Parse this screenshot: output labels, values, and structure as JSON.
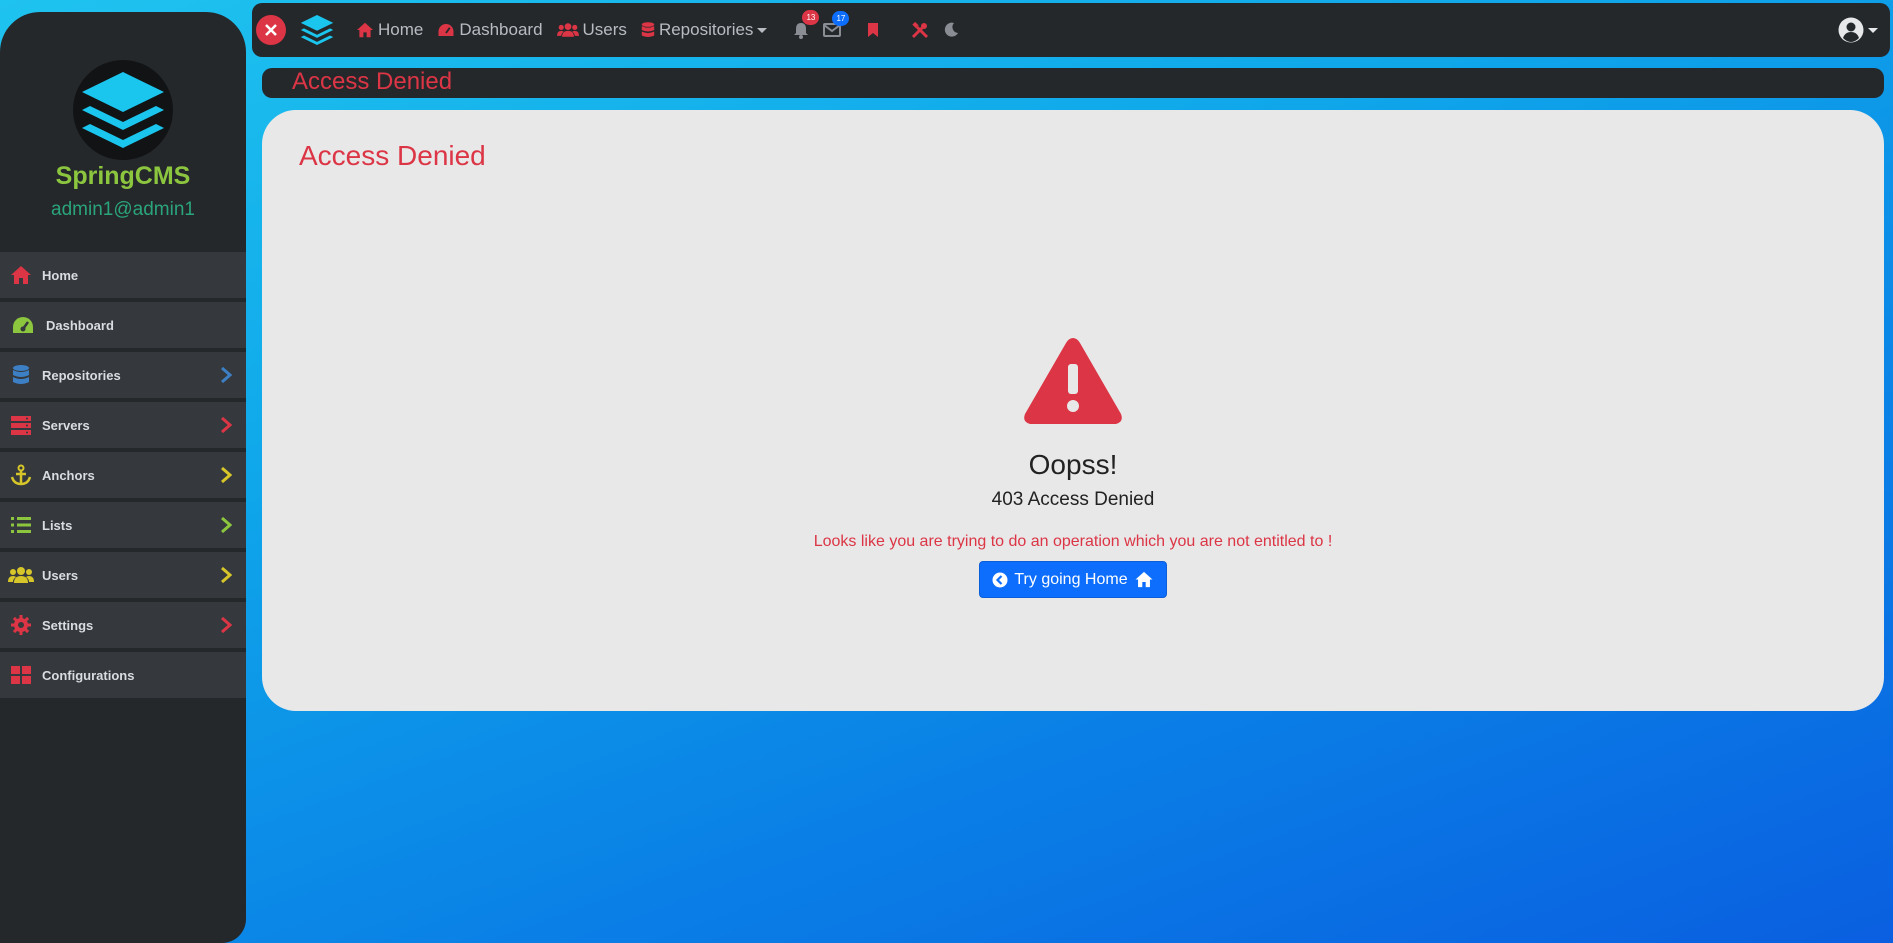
{
  "brand": {
    "name": "SpringCMS",
    "user": "admin1@admin1"
  },
  "sidebar": {
    "items": [
      {
        "label": "Home",
        "icon": "home-icon",
        "color": "#dc3545",
        "has_children": false
      },
      {
        "label": "Dashboard",
        "icon": "gauge-icon",
        "color": "#8cc63f",
        "has_children": false
      },
      {
        "label": "Repositories",
        "icon": "database-icon",
        "color": "#3d7fc4",
        "has_children": true,
        "chevron_color": "#3d7fc4"
      },
      {
        "label": "Servers",
        "icon": "server-icon",
        "color": "#dc3545",
        "has_children": true,
        "chevron_color": "#dc3545"
      },
      {
        "label": "Anchors",
        "icon": "anchor-icon",
        "color": "#d6c62a",
        "has_children": true,
        "chevron_color": "#d6c62a"
      },
      {
        "label": "Lists",
        "icon": "list-icon",
        "color": "#8cc63f",
        "has_children": true,
        "chevron_color": "#8cc63f"
      },
      {
        "label": "Users",
        "icon": "users-icon",
        "color": "#d6c62a",
        "has_children": true,
        "chevron_color": "#d6c62a"
      },
      {
        "label": "Settings",
        "icon": "gear-icon",
        "color": "#dc3545",
        "has_children": true,
        "chevron_color": "#dc3545"
      },
      {
        "label": "Configurations",
        "icon": "grid-icon",
        "color": "#dc3545",
        "has_children": false
      }
    ]
  },
  "topbar": {
    "nav": [
      {
        "label": "Home",
        "icon": "home-icon"
      },
      {
        "label": "Dashboard",
        "icon": "gauge-icon"
      },
      {
        "label": "Users",
        "icon": "users-icon"
      },
      {
        "label": "Repositories",
        "icon": "database-icon",
        "dropdown": true
      }
    ],
    "notifications_count": "13",
    "messages_count": "17"
  },
  "page": {
    "title": "Access Denied",
    "card_title": "Access Denied",
    "heading": "Oopss!",
    "code": "403 Access Denied",
    "message": "Looks like you are trying to do an operation which you are not entitled to !",
    "button_label": "Try going Home"
  },
  "colors": {
    "accent_red": "#dc3545",
    "primary_blue": "#0d6efd",
    "brand_green": "#8cc63f",
    "sidebar_bg": "#25282b"
  }
}
